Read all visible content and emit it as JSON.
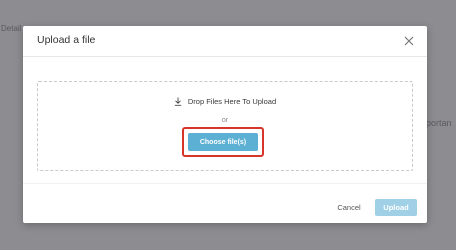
{
  "background": {
    "left_text": "Detail",
    "right_text": "portan"
  },
  "modal": {
    "title": "Upload a file",
    "close_icon": "close-icon",
    "dropzone": {
      "icon": "download-icon",
      "text": "Drop Files Here To Upload",
      "or_text": "or",
      "choose_label": "Choose file(s)"
    },
    "footer": {
      "cancel_label": "Cancel",
      "upload_label": "Upload"
    }
  },
  "colors": {
    "overlay": "#8d8d91",
    "accent": "#5bb0d3",
    "upload_disabled": "#9fd0e6",
    "highlight": "#d8352a"
  }
}
